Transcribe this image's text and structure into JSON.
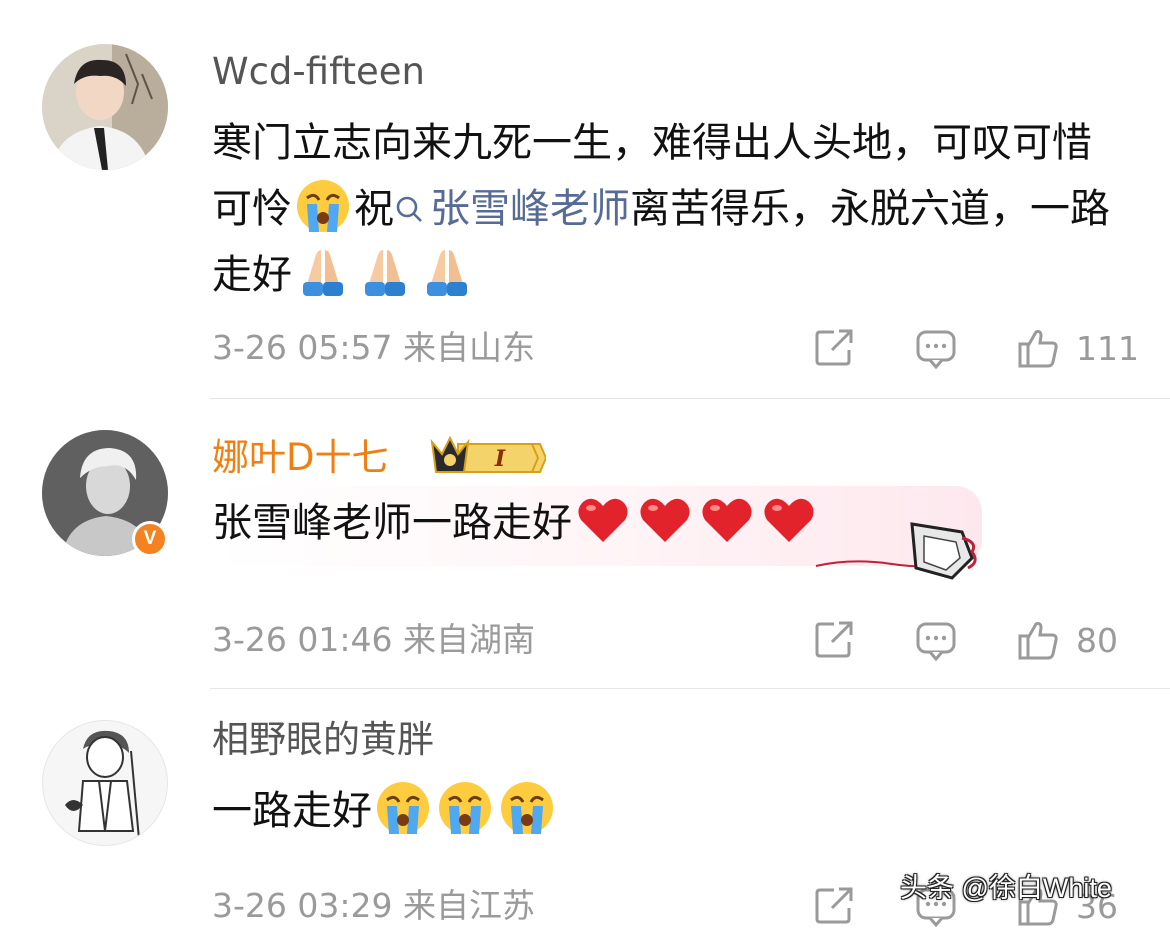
{
  "comments": [
    {
      "username": "Wcd-fifteen",
      "text_a": "寒门立志向来九死一生，难得出人头地，可叹可惜可怜",
      "text_b": "祝",
      "mention": "张雪峰老师",
      "text_c": "离苦得乐，永脱六道，一路走好",
      "emojis": [
        "crying-face",
        "folded-hands",
        "folded-hands",
        "folded-hands"
      ],
      "date": "3-26 05:57",
      "location": "来自山东",
      "likes": "111"
    },
    {
      "username": "娜叶D十七",
      "badge_text": "I",
      "text": "张雪峰老师一路走好",
      "emojis": [
        "red-heart",
        "red-heart",
        "red-heart",
        "red-heart"
      ],
      "date": "3-26 01:46",
      "location": "来自湖南",
      "likes": "80"
    },
    {
      "username": "相野眼的黄胖",
      "text": "一路走好",
      "emojis": [
        "crying-face",
        "crying-face",
        "crying-face"
      ],
      "date": "3-26 03:29",
      "location": "来自江苏",
      "likes": "36"
    }
  ],
  "watermark": "头条 @徐白White",
  "colors": {
    "mention": "#576b95",
    "vip_username": "#f07f11",
    "meta_gray": "#9a9a9a",
    "verified_badge": "#f58220"
  }
}
